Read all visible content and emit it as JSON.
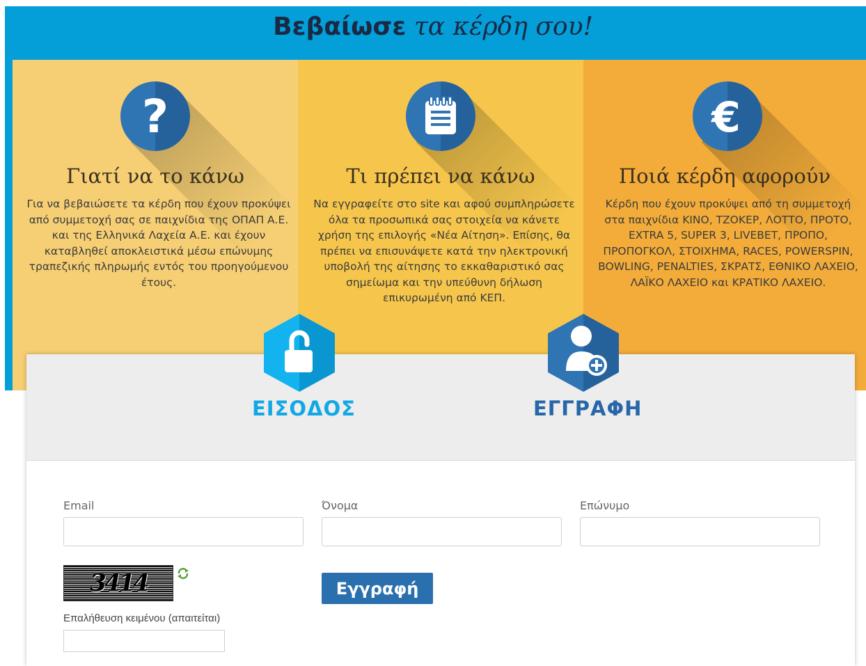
{
  "hero": {
    "title_strong": "Βεβαίωσε",
    "title_light": "τα κέρδη σου!"
  },
  "columns": [
    {
      "icon": "question-icon",
      "title": "Γιατί να το κάνω",
      "text": "Για να βεβαιώσετε τα κέρδη που έχουν προκύψει από συμμετοχή σας σε παιχνίδια της ΟΠΑΠ Α.Ε. και της Ελληνικά Λαχεία Α.Ε. και έχουν καταβληθεί αποκλειστικά μέσω επώνυμης τραπεζικής πληρωμής εντός του προηγούμενου έτους."
    },
    {
      "icon": "notepad-icon",
      "title": "Τι πρέπει να κάνω",
      "text": "Να εγγραφείτε στο site και αφού συμπληρώσετε όλα τα προσωπικά σας στοιχεία να κάνετε χρήση της επιλογής «Νέα Αίτηση». Επίσης, θα πρέπει να επισυνάψετε κατά την ηλεκτρονική υποβολή της αίτησης το εκκαθαριστικό σας σημείωμα και την υπεύθυνη δήλωση επικυρωμένη από ΚΕΠ."
    },
    {
      "icon": "euro-icon",
      "title": "Ποιά κέρδη αφορούν",
      "text": "Κέρδη που έχουν προκύψει από τη συμμετοχή στα παιχνίδια ΚΙΝΟ, ΤΖΟΚΕΡ, ΛΟΤΤΟ, ΠΡΟΤΟ, EXTRA 5, SUPER 3, LIVEBET, ΠΡΟΠΟ, ΠΡΟΠΟΓΚΟΛ, ΣΤΟΙΧΗΜΑ, RACES, POWERSPIN, BOWLING, PENALTIES, ΣΚΡΑΤΣ, ΕΘΝΙΚΟ ΛΑΧΕΙΟ, ΛΑΪΚΟ ΛΑΧΕΙΟ και ΚΡΑΤΙΚΟ ΛΑΧΕΙΟ."
    }
  ],
  "tabs": {
    "login": "ΕΙΣΟΔΟΣ",
    "register": "ΕΓΓΡΑΦΗ"
  },
  "form": {
    "email_label": "Email",
    "email_value": "",
    "first_name_label": "Όνομα",
    "first_name_value": "",
    "last_name_label": "Επώνυμο",
    "last_name_value": "",
    "captcha_text": "3414",
    "verify_label": "Επαλήθευση κειμένου (απαιτείται)",
    "submit_label": "Εγγραφή"
  },
  "colors": {
    "band": "#049fd9",
    "col1": "#f6cf74",
    "col2": "#f6c64c",
    "col3": "#f3ac3a",
    "primary": "#2a6fae",
    "login_accent": "#12a8e6"
  }
}
